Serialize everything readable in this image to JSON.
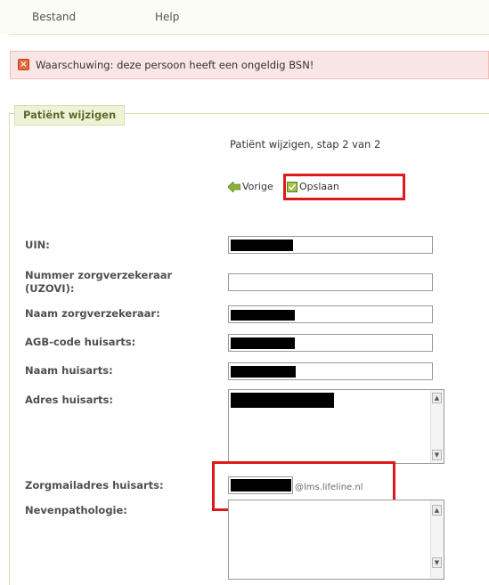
{
  "menu": {
    "file_label": "Bestand",
    "help_label": "Help"
  },
  "warning": {
    "text": "Waarschuwing: deze persoon heeft een ongeldig BSN!",
    "icon": "x-box-icon"
  },
  "form": {
    "legend": "Patiënt wijzigen",
    "step_text": "Patiënt wijzigen, stap 2 van 2",
    "prev_label": "Vorige",
    "save_label": "Opslaan",
    "fields": {
      "uin": {
        "label": "UIN:",
        "value": ""
      },
      "uzovi": {
        "label": "Nummer zorgverzekeraar (UZOVI):",
        "value": ""
      },
      "insurer_name": {
        "label": "Naam zorgverzekeraar:",
        "value": ""
      },
      "agb_code": {
        "label": "AGB-code huisarts:",
        "value": ""
      },
      "gp_name": {
        "label": "Naam huisarts:",
        "value": ""
      },
      "gp_address": {
        "label": "Adres huisarts:",
        "value": ""
      },
      "gp_email": {
        "label": "Zorgmailadres huisarts:",
        "value": "",
        "suffix": "@lms.lifeline.nl"
      },
      "comorbidity": {
        "label": "Nevenpathologie:",
        "value": ""
      }
    }
  },
  "colors": {
    "accent_green": "#8cb13a",
    "highlight_red": "#dd1a1a",
    "warning_bg": "#f9e6e4",
    "legend_bg": "#eef3d7"
  }
}
